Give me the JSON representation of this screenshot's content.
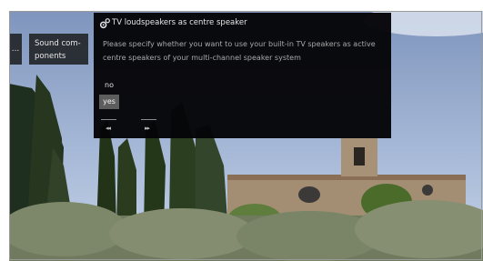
{
  "sidebar": {
    "stub_label": "...",
    "menu_label": "Sound com-\nponents"
  },
  "dialog": {
    "icon": "gear-icon",
    "title": "TV loudspeakers as centre speaker",
    "message": "Please specify whether you want to use your built-in TV speakers as active centre speakers of your multi-channel speaker system",
    "options": [
      "no",
      "yes"
    ],
    "selected": "yes",
    "nav_back": "◂◂",
    "nav_forward": "▸▸"
  },
  "colors": {
    "dialog_bg": "#050508",
    "selected_bg": "#5d5d5d",
    "menu_bg": "#2b2f36"
  }
}
